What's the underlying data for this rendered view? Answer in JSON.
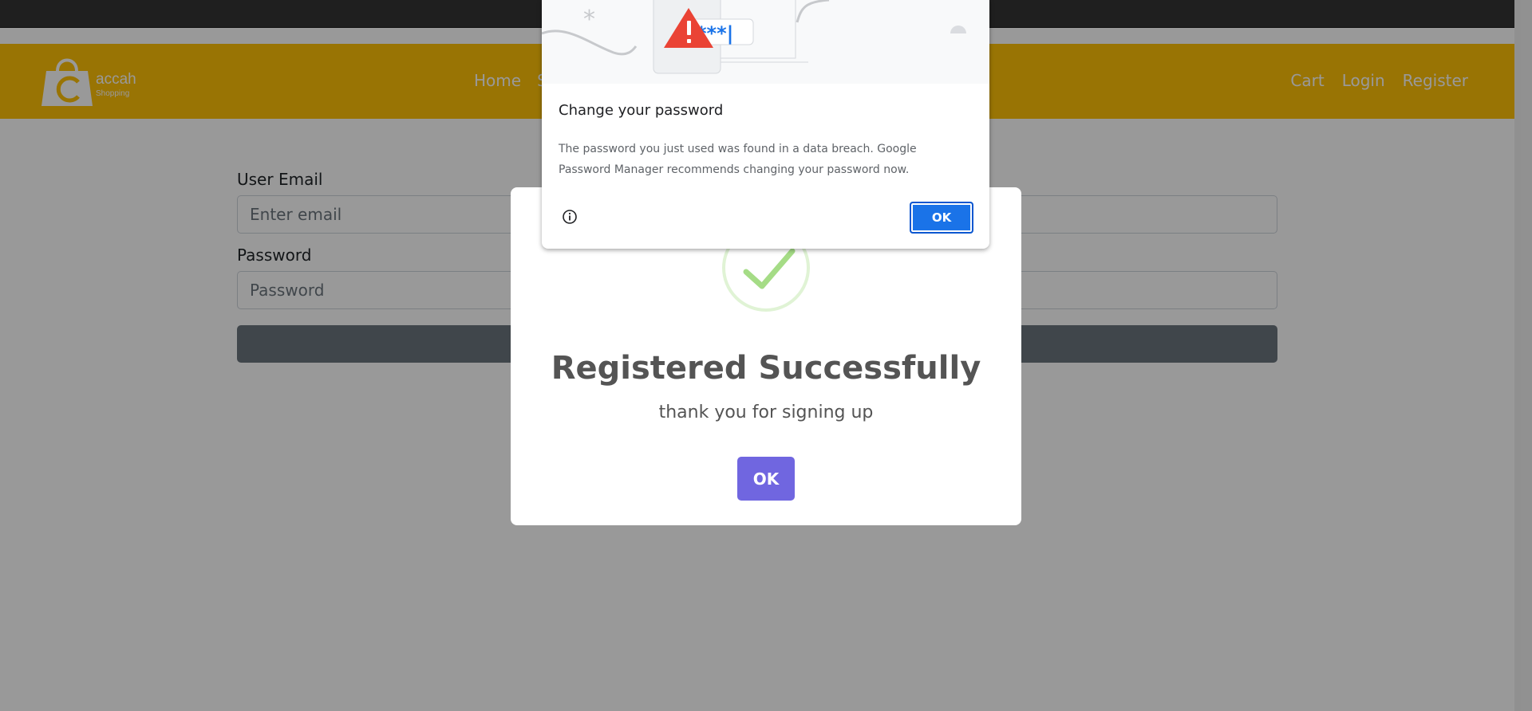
{
  "navbar": {
    "logo_text": "accah",
    "logo_sub": "Shopping",
    "left_links": [
      "Home",
      "S"
    ],
    "right_links": [
      "Cart",
      "Login",
      "Register"
    ]
  },
  "form": {
    "email_label": "User Email",
    "email_placeholder": "Enter email",
    "password_label": "Password",
    "password_placeholder": "Password"
  },
  "success_modal": {
    "title": "Registered Successfully",
    "text": "thank you for signing up",
    "ok_label": "OK"
  },
  "password_popup": {
    "masked_preview": "***|",
    "title": "Change your password",
    "body": "The password you just used was found in a data breach. Google Password Manager recommends changing your password now.",
    "ok_label": "OK"
  },
  "colors": {
    "navbar": "#ffc107",
    "modal_button": "#7066e0",
    "chrome_button": "#1a73e8",
    "check": "#a5dc86",
    "warning": "#ea4335"
  }
}
